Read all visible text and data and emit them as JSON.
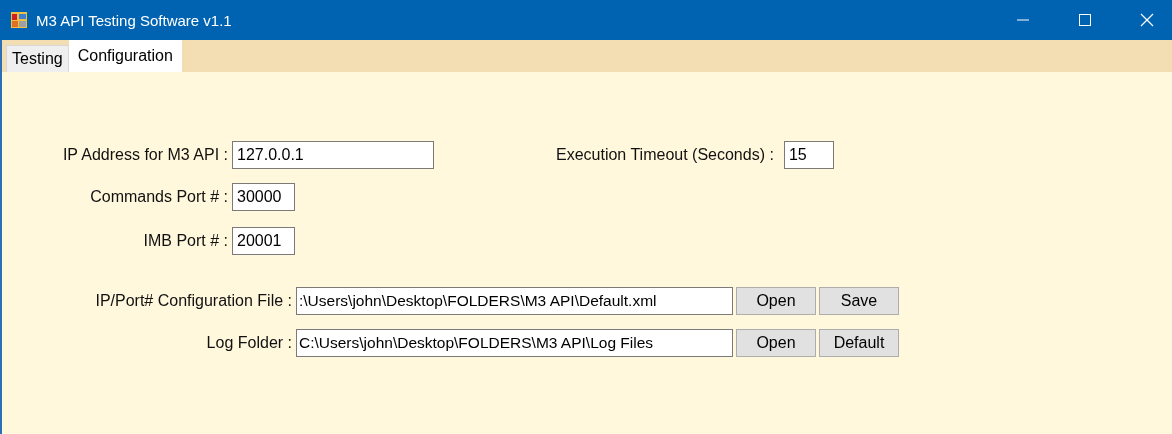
{
  "window": {
    "title": "M3 API Testing Software v1.1"
  },
  "tabs": [
    {
      "label": "Testing",
      "selected": false
    },
    {
      "label": "Configuration",
      "selected": true
    }
  ],
  "ip_address": {
    "label": "IP Address for M3 API :",
    "value": "127.0.0.1"
  },
  "execution_timeout": {
    "label": "Execution Timeout (Seconds) :",
    "value": "15"
  },
  "commands_port": {
    "label": "Commands Port # :",
    "value": "30000"
  },
  "imb_port": {
    "label": "IMB Port # :",
    "value": "20001"
  },
  "config_file": {
    "label": "IP/Port# Configuration File :",
    "value": ":\\Users\\john\\Desktop\\FOLDERS\\M3 API\\Default.xml",
    "buttons": [
      "Open",
      "Save"
    ]
  },
  "log_folder": {
    "label": "Log Folder :",
    "value": "C:\\Users\\john\\Desktop\\FOLDERS\\M3 API\\Log Files",
    "buttons": [
      "Open",
      "Default"
    ]
  }
}
